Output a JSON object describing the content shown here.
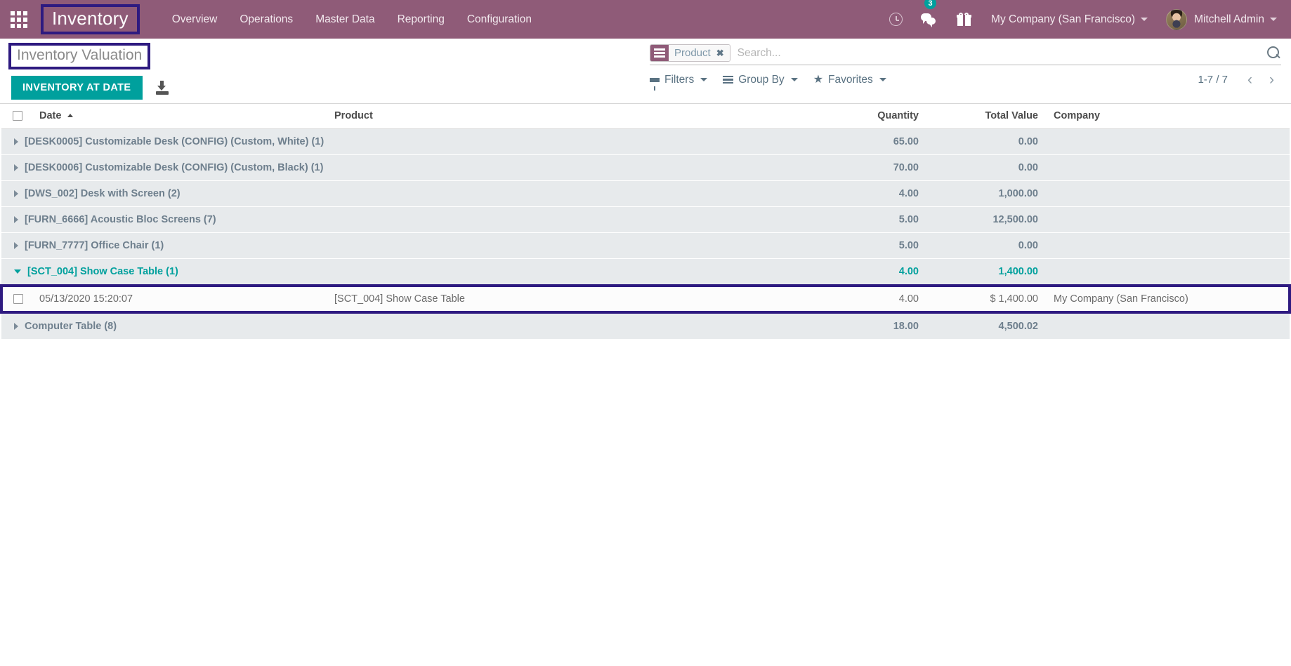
{
  "navbar": {
    "apps_icon": "apps-grid-icon",
    "brand": "Inventory",
    "menu": [
      {
        "label": "Overview"
      },
      {
        "label": "Operations"
      },
      {
        "label": "Master Data"
      },
      {
        "label": "Reporting"
      },
      {
        "label": "Configuration"
      }
    ],
    "activity_icon": "clock-icon",
    "messages_icon": "chat-bubbles-icon",
    "messages_count": "3",
    "gift_icon": "gift-icon",
    "company": "My Company (San Francisco)",
    "user": "Mitchell Admin",
    "accent_color": "#8f5b78",
    "badge_color": "#00a09d"
  },
  "control_panel": {
    "breadcrumb": "Inventory Valuation",
    "primary_button": "INVENTORY AT DATE",
    "download_icon": "download-icon",
    "highlight_color": "#2e1a80",
    "primary_color": "#00a09d"
  },
  "search": {
    "facet": {
      "icon": "group-by-icon",
      "label": "Product",
      "remove_icon": "close-icon"
    },
    "placeholder": "Search...",
    "value": "",
    "search_icon": "search-icon"
  },
  "toolbar": {
    "filters": "Filters",
    "group_by": "Group By",
    "favorites": "Favorites",
    "filters_icon": "funnel-icon",
    "group_by_icon": "list-lines-icon",
    "favorites_icon": "star-icon"
  },
  "pager": {
    "count": "1-7 / 7",
    "prev_icon": "chevron-left-icon",
    "next_icon": "chevron-right-icon",
    "prev": "‹",
    "next": "›"
  },
  "table": {
    "columns": {
      "select": "",
      "date": "Date",
      "product": "Product",
      "quantity": "Quantity",
      "total_value": "Total Value",
      "company": "Company"
    },
    "sort_column": "Date",
    "sort_direction": "asc",
    "rows": [
      {
        "type": "group",
        "expanded": false,
        "label": "[DESK0005] Customizable Desk (CONFIG) (Custom, White) (1)",
        "quantity": "65.00",
        "total_value": "0.00"
      },
      {
        "type": "group",
        "expanded": false,
        "label": "[DESK0006] Customizable Desk (CONFIG) (Custom, Black) (1)",
        "quantity": "70.00",
        "total_value": "0.00"
      },
      {
        "type": "group",
        "expanded": false,
        "label": "[DWS_002] Desk with Screen (2)",
        "quantity": "4.00",
        "total_value": "1,000.00"
      },
      {
        "type": "group",
        "expanded": false,
        "label": "[FURN_6666] Acoustic Bloc Screens (7)",
        "quantity": "5.00",
        "total_value": "12,500.00"
      },
      {
        "type": "group",
        "expanded": false,
        "label": "[FURN_7777] Office Chair (1)",
        "quantity": "5.00",
        "total_value": "0.00"
      },
      {
        "type": "group",
        "expanded": true,
        "label": "[SCT_004] Show Case Table (1)",
        "quantity": "4.00",
        "total_value": "1,400.00"
      },
      {
        "type": "record",
        "highlighted": true,
        "date": "05/13/2020 15:20:07",
        "product": "[SCT_004] Show Case Table",
        "quantity": "4.00",
        "total_value": "$ 1,400.00",
        "company": "My Company (San Francisco)"
      },
      {
        "type": "group",
        "expanded": false,
        "label": "Computer Table (8)",
        "quantity": "18.00",
        "total_value": "4,500.02"
      }
    ]
  }
}
